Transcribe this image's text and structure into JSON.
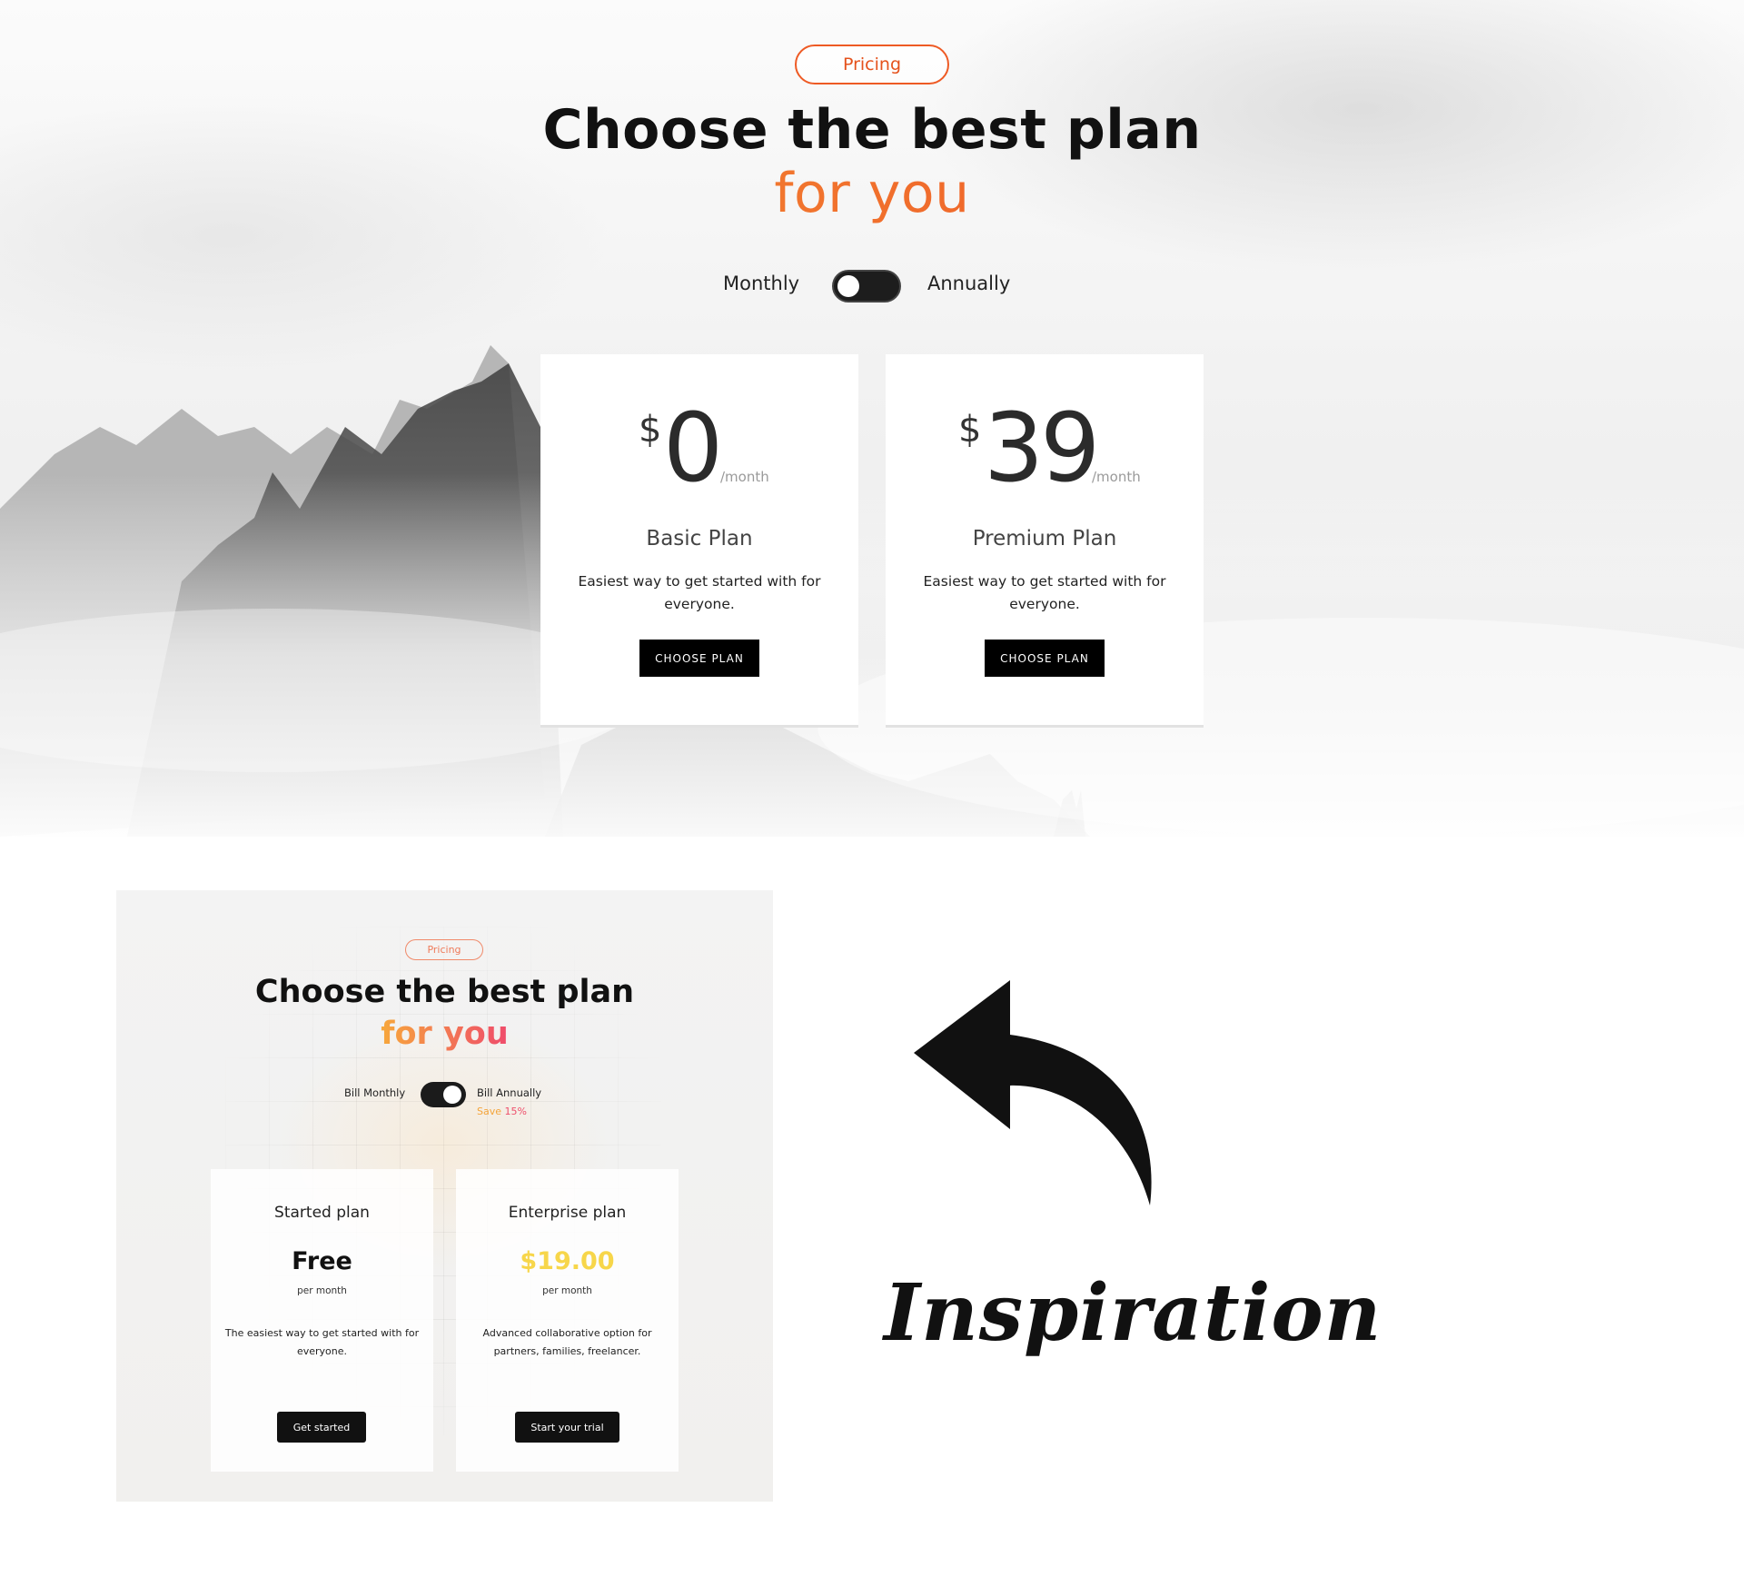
{
  "hero": {
    "badge": "Pricing",
    "title": "Choose the best plan",
    "subtitle": "for you",
    "billing": {
      "left_label": "Monthly",
      "right_label": "Annually",
      "toggle_state": "monthly"
    },
    "plans": [
      {
        "currency": "$",
        "amount": "0",
        "period": "/month",
        "name": "Basic Plan",
        "description": "Easiest way to get started with for everyone.",
        "button": "CHOOSE PLAN"
      },
      {
        "currency": "$",
        "amount": "39",
        "period": "/month",
        "name": "Premium Plan",
        "description": "Easiest way to get started with for everyone.",
        "button": "CHOOSE PLAN"
      }
    ]
  },
  "inspiration": {
    "badge": "Pricing",
    "title": "Choose the best plan",
    "subtitle": "for you",
    "bill_monthly": "Bill Monthly",
    "bill_annually": "Bill Annually",
    "save_label": "Save",
    "save_value": "15%",
    "toggle_state": "annually",
    "plans": [
      {
        "name": "Started plan",
        "price": "Free",
        "period": "per month",
        "description": "The easiest way to get started with for everyone.",
        "button": "Get started"
      },
      {
        "name": "Enterprise plan",
        "price": "$19.00",
        "period": "per month",
        "description": "Advanced collaborative option for partners, families, freelancer.",
        "button": "Start your trial"
      }
    ],
    "caption": "Inspiration"
  },
  "colors": {
    "accent_orange": "#ee5a24",
    "gradient_start": "#f4a63a",
    "gradient_end": "#e8322c",
    "button_bg": "#000000",
    "enterprise_price": "#f7d64a"
  },
  "icons": {
    "arrow": "curved-arrow-icon",
    "background": "misty-mountains"
  }
}
